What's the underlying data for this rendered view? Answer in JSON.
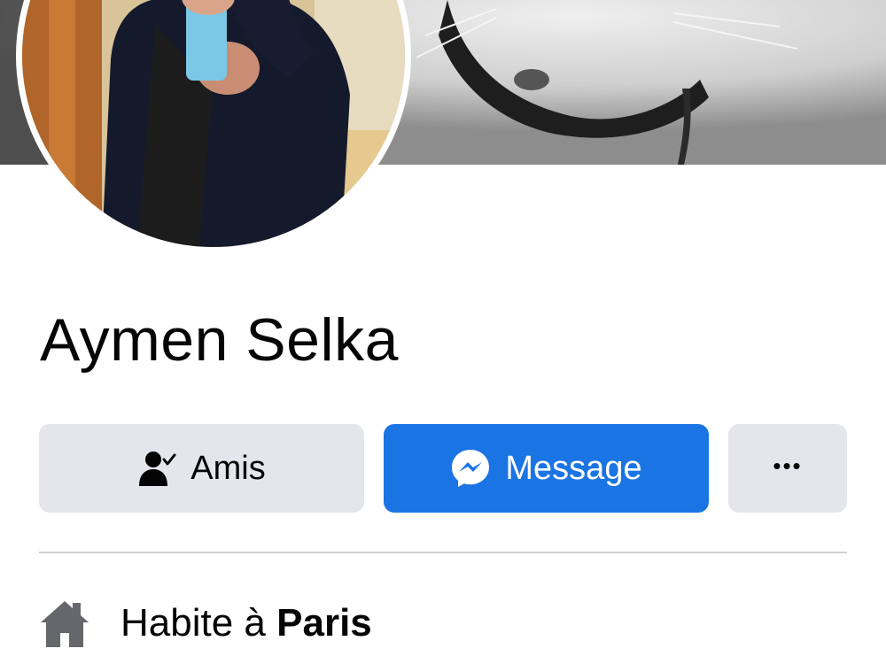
{
  "profile": {
    "name": "Aymen Selka"
  },
  "actions": {
    "friends_label": "Amis",
    "message_label": "Message",
    "more_label": "•••"
  },
  "intro": {
    "lives_prefix": "Habite à",
    "lives_city": "Paris"
  },
  "icons": {
    "friends": "person-check-icon",
    "message": "messenger-icon",
    "more": "more-dots-icon",
    "home": "home-icon"
  },
  "colors": {
    "primary_button": "#1b74e4",
    "secondary_button": "#e4e6eb",
    "text": "#050505",
    "divider": "#ced0d4",
    "icon_gray": "#65676b"
  }
}
